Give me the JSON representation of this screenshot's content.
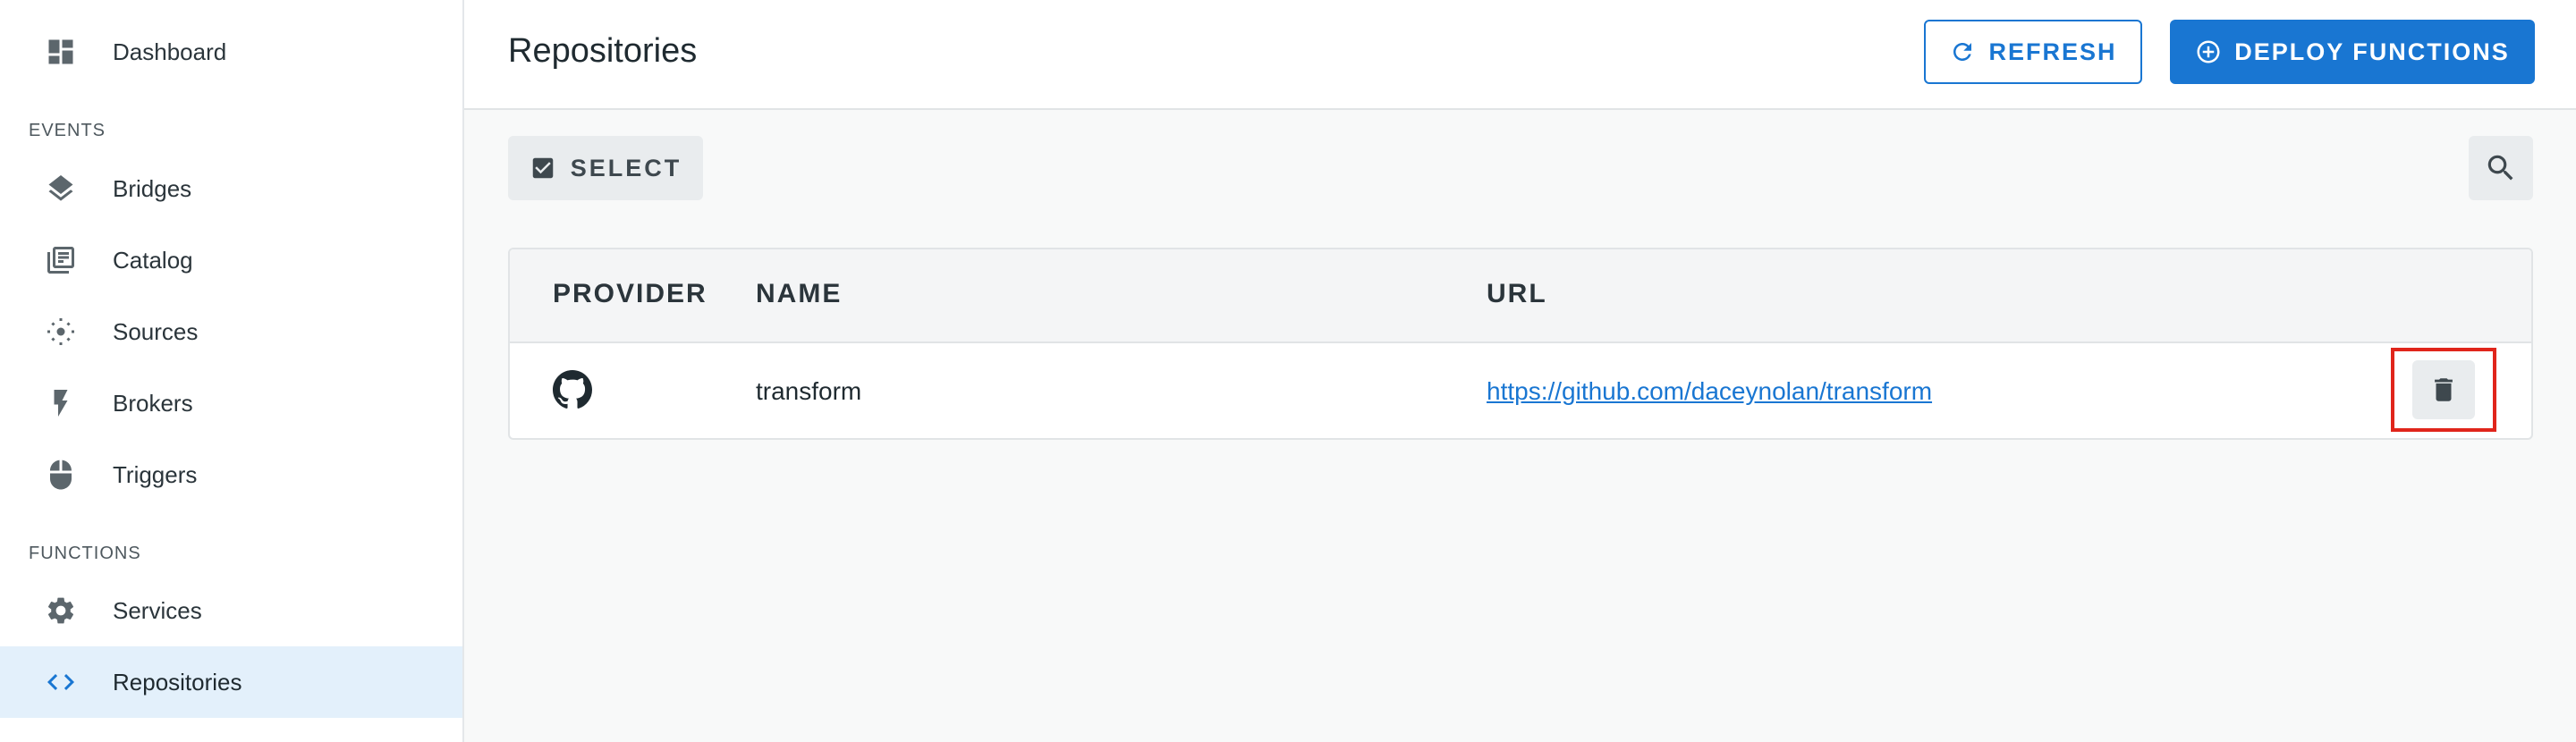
{
  "sidebar": {
    "items": [
      {
        "label": "Dashboard",
        "icon": "dashboard-icon"
      },
      {
        "label": "Bridges",
        "icon": "layers-icon"
      },
      {
        "label": "Catalog",
        "icon": "library-books-icon"
      },
      {
        "label": "Sources",
        "icon": "target-icon"
      },
      {
        "label": "Brokers",
        "icon": "flash-icon"
      },
      {
        "label": "Triggers",
        "icon": "mouse-icon"
      },
      {
        "label": "Services",
        "icon": "gear-icon"
      },
      {
        "label": "Repositories",
        "icon": "code-icon",
        "active": true
      }
    ],
    "sections": {
      "events": "EVENTS",
      "functions": "FUNCTIONS"
    }
  },
  "header": {
    "title": "Repositories",
    "refresh_label": "REFRESH",
    "deploy_label": "DEPLOY FUNCTIONS"
  },
  "toolbar": {
    "select_label": "SELECT"
  },
  "table": {
    "columns": [
      "PROVIDER",
      "NAME",
      "URL"
    ],
    "rows": [
      {
        "provider_icon": "github-icon",
        "name": "transform",
        "url": "https://github.com/daceynolan/transform"
      }
    ]
  },
  "colors": {
    "accent": "#1976d2",
    "active_bg": "#e3f0fb",
    "highlight": "#e0251b"
  }
}
